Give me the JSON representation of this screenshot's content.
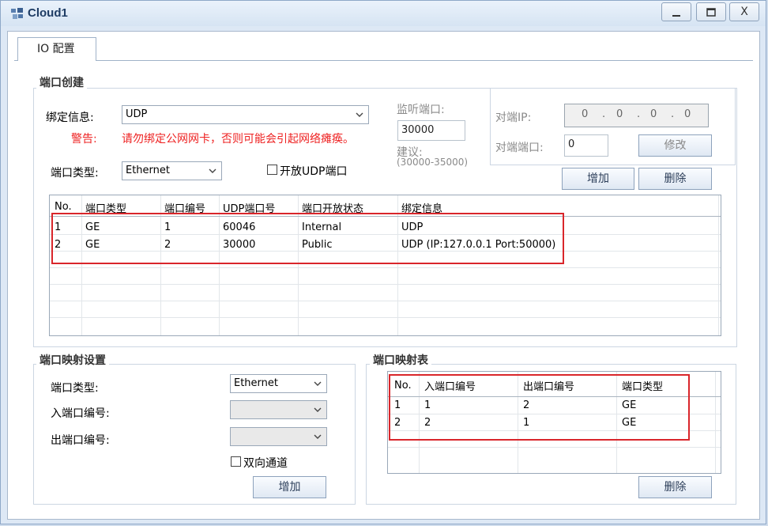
{
  "window": {
    "title": "Cloud1",
    "minimize_icon": "minimize-icon",
    "maximize_icon": "maximize-icon",
    "close_label": "X"
  },
  "tabs": [
    {
      "label": "IO 配置"
    }
  ],
  "port_create": {
    "title": "端口创建",
    "bind_label": "绑定信息:",
    "bind_value": "UDP",
    "warning_label": "警告:",
    "warning_text": "请勿绑定公网网卡，否则可能会引起网络瘫痪。",
    "port_type_label": "端口类型:",
    "port_type_value": "Ethernet",
    "open_udp_label": "开放UDP端口",
    "listen_port_label": "监听端口:",
    "listen_port_value": "30000",
    "suggest_label": "建议:",
    "suggest_range": "(30000-35000)",
    "peer_ip_label": "对端IP:",
    "peer_ip_octets": [
      "0",
      "0",
      "0",
      "0"
    ],
    "peer_port_label": "对端端口:",
    "peer_port_value": "0",
    "modify_button": "修改",
    "add_button": "增加",
    "delete_button": "删除",
    "table": {
      "headers": [
        "No.",
        "端口类型",
        "端口编号",
        "UDP端口号",
        "端口开放状态",
        "绑定信息"
      ],
      "rows": [
        [
          "1",
          "GE",
          "1",
          "60046",
          "Internal",
          "UDP"
        ],
        [
          "2",
          "GE",
          "2",
          "30000",
          "Public",
          "UDP (IP:127.0.0.1 Port:50000)"
        ]
      ]
    }
  },
  "port_map_settings": {
    "title": "端口映射设置",
    "port_type_label": "端口类型:",
    "port_type_value": "Ethernet",
    "in_port_label": "入端口编号:",
    "in_port_value": "",
    "out_port_label": "出端口编号:",
    "out_port_value": "",
    "bidirectional_label": "双向通道",
    "add_button": "增加"
  },
  "port_map_table": {
    "title": "端口映射表",
    "headers": [
      "No.",
      "入端口编号",
      "出端口编号",
      "端口类型"
    ],
    "rows": [
      [
        "1",
        "1",
        "2",
        "GE"
      ],
      [
        "2",
        "2",
        "1",
        "GE"
      ]
    ],
    "delete_button": "删除"
  },
  "colors": {
    "highlight": "#d9262b",
    "warning": "#e22222"
  }
}
